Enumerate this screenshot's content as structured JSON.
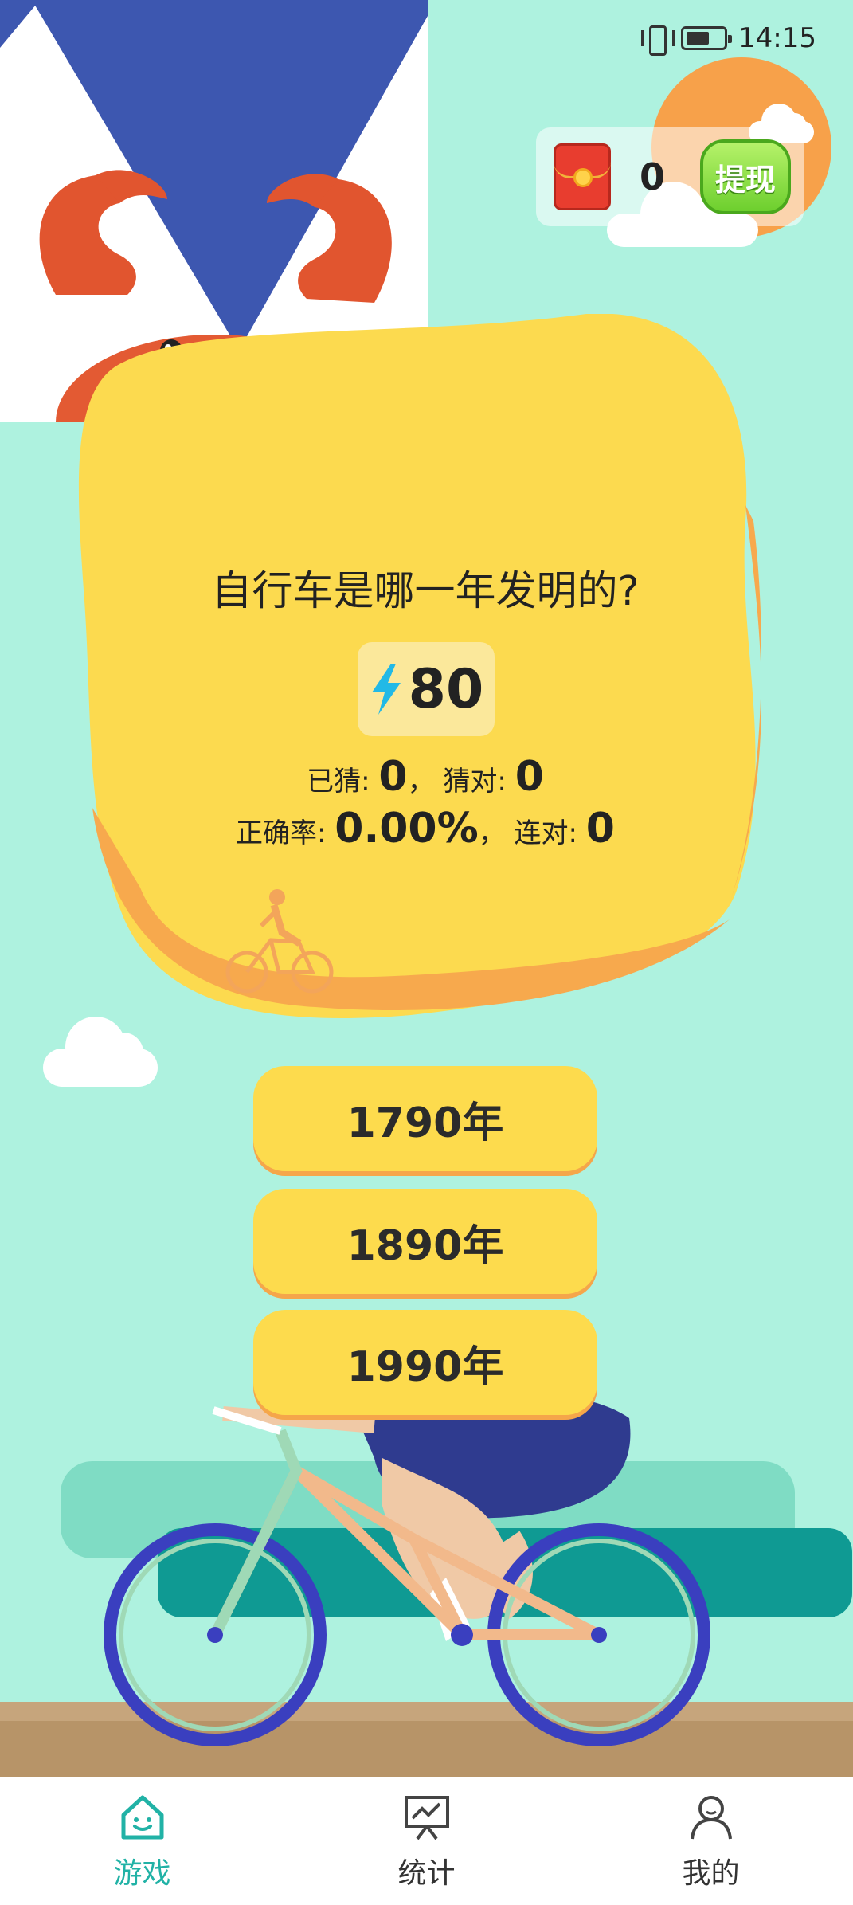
{
  "status_bar": {
    "time": "14:15"
  },
  "wallet": {
    "balance": "0",
    "withdraw_label": "提现"
  },
  "question": {
    "text": "自行车是哪一年发明的?",
    "energy": "80",
    "guessed_label": "已猜:",
    "guessed_value": "0",
    "correct_label": "猜对:",
    "correct_value": "0",
    "accuracy_label": "正确率:",
    "accuracy_value": "0.00%",
    "streak_label": "连对:",
    "streak_value": "0"
  },
  "answers": [
    {
      "label": "1790年"
    },
    {
      "label": "1890年"
    },
    {
      "label": "1990年"
    }
  ],
  "tabs": [
    {
      "label": "游戏",
      "icon": "home-smile-icon",
      "active": true
    },
    {
      "label": "统计",
      "icon": "chart-board-icon",
      "active": false
    },
    {
      "label": "我的",
      "icon": "person-icon",
      "active": false
    }
  ],
  "colors": {
    "background": "#aef2df",
    "card": "#fcda4f",
    "answer_button": "#fddb4d",
    "tab_active": "#21b2a6",
    "withdraw_button": "#6dcf2e"
  }
}
